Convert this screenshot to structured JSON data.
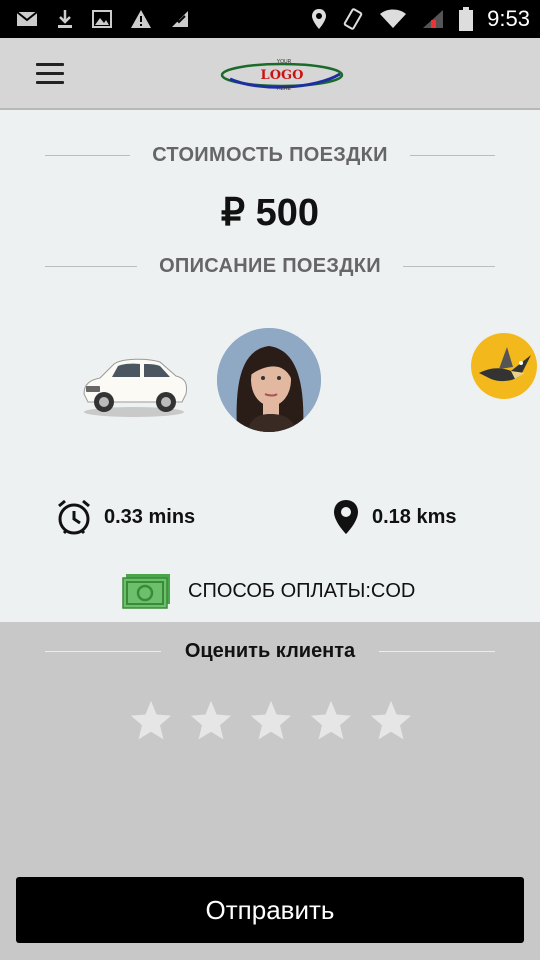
{
  "status_bar": {
    "time": "9:53",
    "icons_left": [
      "mail-icon",
      "download-icon",
      "image-icon",
      "warning-icon",
      "signal-check-icon"
    ],
    "icons_right": [
      "location-icon",
      "vibrate-icon",
      "wifi-icon",
      "cell-signal-icon",
      "battery-icon"
    ]
  },
  "app_bar": {
    "logo_text": "LOGO",
    "logo_top_text": "YOUR",
    "logo_bottom_text": "HERE"
  },
  "trip": {
    "cost_heading": "СТОИМОСТЬ ПОЕЗДКИ",
    "price": "₽ 500",
    "description_heading": "ОПИСАНИЕ ПОЕЗДКИ",
    "duration": "0.33 mins",
    "distance": "0.18 kms",
    "payment": "СПОСОБ ОПЛАТЫ:COD"
  },
  "rating": {
    "heading": "Оценить клиента",
    "value": 0,
    "max": 5
  },
  "submit_label": "Отправить",
  "colors": {
    "card_bg": "#eef1f2",
    "rating_bg": "#c8c8c8",
    "badge_yellow": "#f3b81b",
    "button_bg": "#000000",
    "star_empty": "#e6e6e6"
  }
}
